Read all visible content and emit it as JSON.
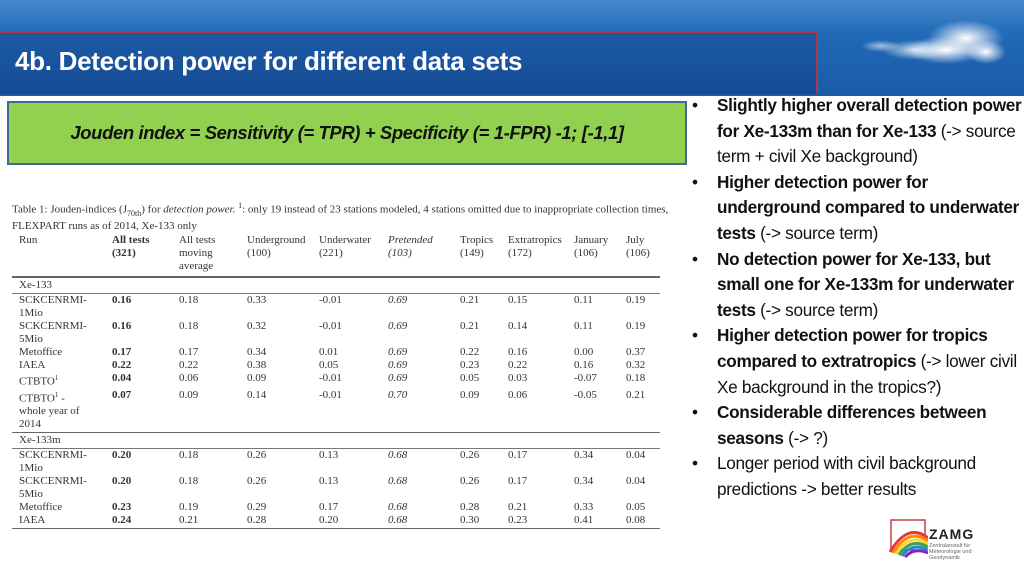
{
  "slide": {
    "title": "4b. Detection power for different data sets",
    "formula": "Jouden index = Sensitivity (= TPR) + Specificity (= 1-FPR) -1; [-1,1]"
  },
  "table": {
    "caption": {
      "part1": "Table 1: Jouden-indices (J",
      "subscript": "70th",
      "part2": ") for ",
      "italic": "detection power.",
      "sup": "1",
      "part3": ": only 19 instead of 23 stations modeled, 4 stations omitted due to inappropriate collection times, FLEXPART runs as of 2014, Xe-133 only"
    },
    "headers": [
      {
        "line1": "Run",
        "line2": "",
        "line3": ""
      },
      {
        "line1": "All tests",
        "line2": "(321)",
        "line3": ""
      },
      {
        "line1": "All tests",
        "line2": "moving",
        "line3": "average"
      },
      {
        "line1": "Underground",
        "line2": "(100)",
        "line3": ""
      },
      {
        "line1": "Underwater",
        "line2": "(221)",
        "line3": ""
      },
      {
        "line1": "Pretended",
        "line2": "(103)",
        "line3": ""
      },
      {
        "line1": "Tropics",
        "line2": "(149)",
        "line3": ""
      },
      {
        "line1": "Extratropics",
        "line2": "(172)",
        "line3": ""
      },
      {
        "line1": "January",
        "line2": "(106)",
        "line3": ""
      },
      {
        "line1": "July",
        "line2": "(106)",
        "line3": ""
      }
    ],
    "sections": [
      {
        "name": "Xe-133",
        "rows": [
          {
            "run": "SCKCENRMI-",
            "run2": "1Mio",
            "sup": "",
            "run_extra": "",
            "values": [
              "0.16",
              "0.18",
              "0.33",
              "-0.01",
              "0.69",
              "0.21",
              "0.15",
              "0.11",
              "0.19"
            ]
          },
          {
            "run": "SCKCENRMI-",
            "run2": "5Mio",
            "sup": "",
            "run_extra": "",
            "values": [
              "0.16",
              "0.18",
              "0.32",
              "-0.01",
              "0.69",
              "0.21",
              "0.14",
              "0.11",
              "0.19"
            ]
          },
          {
            "run": "Metoffice",
            "run2": "",
            "sup": "",
            "run_extra": "",
            "values": [
              "0.17",
              "0.17",
              "0.34",
              "0.01",
              "0.69",
              "0.22",
              "0.16",
              "0.00",
              "0.37"
            ]
          },
          {
            "run": "IAEA",
            "run2": "",
            "sup": "",
            "run_extra": "",
            "values": [
              "0.22",
              "0.22",
              "0.38",
              "0.05",
              "0.69",
              "0.23",
              "0.22",
              "0.16",
              "0.32"
            ]
          },
          {
            "run": "CTBTO",
            "run2": "",
            "sup": "1",
            "run_extra": "",
            "values": [
              "0.04",
              "0.06",
              "0.09",
              "-0.01",
              "0.69",
              "0.05",
              "0.03",
              "-0.07",
              "0.18"
            ]
          },
          {
            "run": "CTBTO",
            "run2": "whole year of",
            "sup": "1",
            "run_extra": " -",
            "run3": "2014",
            "values": [
              "0.07",
              "0.09",
              "0.14",
              "-0.01",
              "0.70",
              "0.09",
              "0.06",
              "-0.05",
              "0.21"
            ]
          }
        ]
      },
      {
        "name": "Xe-133m",
        "rows": [
          {
            "run": "SCKCENRMI-",
            "run2": "1Mio",
            "sup": "",
            "run_extra": "",
            "values": [
              "0.20",
              "0.18",
              "0.26",
              "0.13",
              "0.68",
              "0.26",
              "0.17",
              "0.34",
              "0.04"
            ]
          },
          {
            "run": "SCKCENRMI-",
            "run2": "5Mio",
            "sup": "",
            "run_extra": "",
            "values": [
              "0.20",
              "0.18",
              "0.26",
              "0.13",
              "0.68",
              "0.26",
              "0.17",
              "0.34",
              "0.04"
            ]
          },
          {
            "run": "Metoffice",
            "run2": "",
            "sup": "",
            "run_extra": "",
            "values": [
              "0.23",
              "0.19",
              "0.29",
              "0.17",
              "0.68",
              "0.28",
              "0.21",
              "0.33",
              "0.05"
            ]
          },
          {
            "run": "IAEA",
            "run2": "",
            "sup": "",
            "run_extra": "",
            "values": [
              "0.24",
              "0.21",
              "0.28",
              "0.20",
              "0.68",
              "0.30",
              "0.23",
              "0.41",
              "0.08"
            ]
          }
        ]
      }
    ]
  },
  "bullets": [
    {
      "bold": "Slightly higher overall detection power for Xe-133m than for Xe-133",
      "normal": " (-> source term + civil Xe background)"
    },
    {
      "bold": "Higher detection power for underground compared to underwater tests",
      "normal": " (-> source term)"
    },
    {
      "bold": "No detection power for Xe-133, but small one for Xe-133m for underwater tests",
      "normal": " (-> source term)"
    },
    {
      "bold": "Higher detection power for tropics compared to extratropics",
      "normal": " (-> lower civil Xe background in the tropics?)"
    },
    {
      "bold": "Considerable differences between seasons",
      "normal": " (-> ?)"
    },
    {
      "bold": "",
      "normal": "Longer period with civil background predictions -> better results"
    }
  ],
  "bullet_glyph": "•",
  "logo": {
    "name": "ZAMG",
    "subtitle": "Zentralanstalt für\nMeteorologie und\nGeodynamik"
  },
  "colors": {
    "header_blue": "#1a5ca8",
    "title_band_border": "#b0364a",
    "formula_green": "#92d050",
    "formula_border": "#3d6b8f"
  }
}
